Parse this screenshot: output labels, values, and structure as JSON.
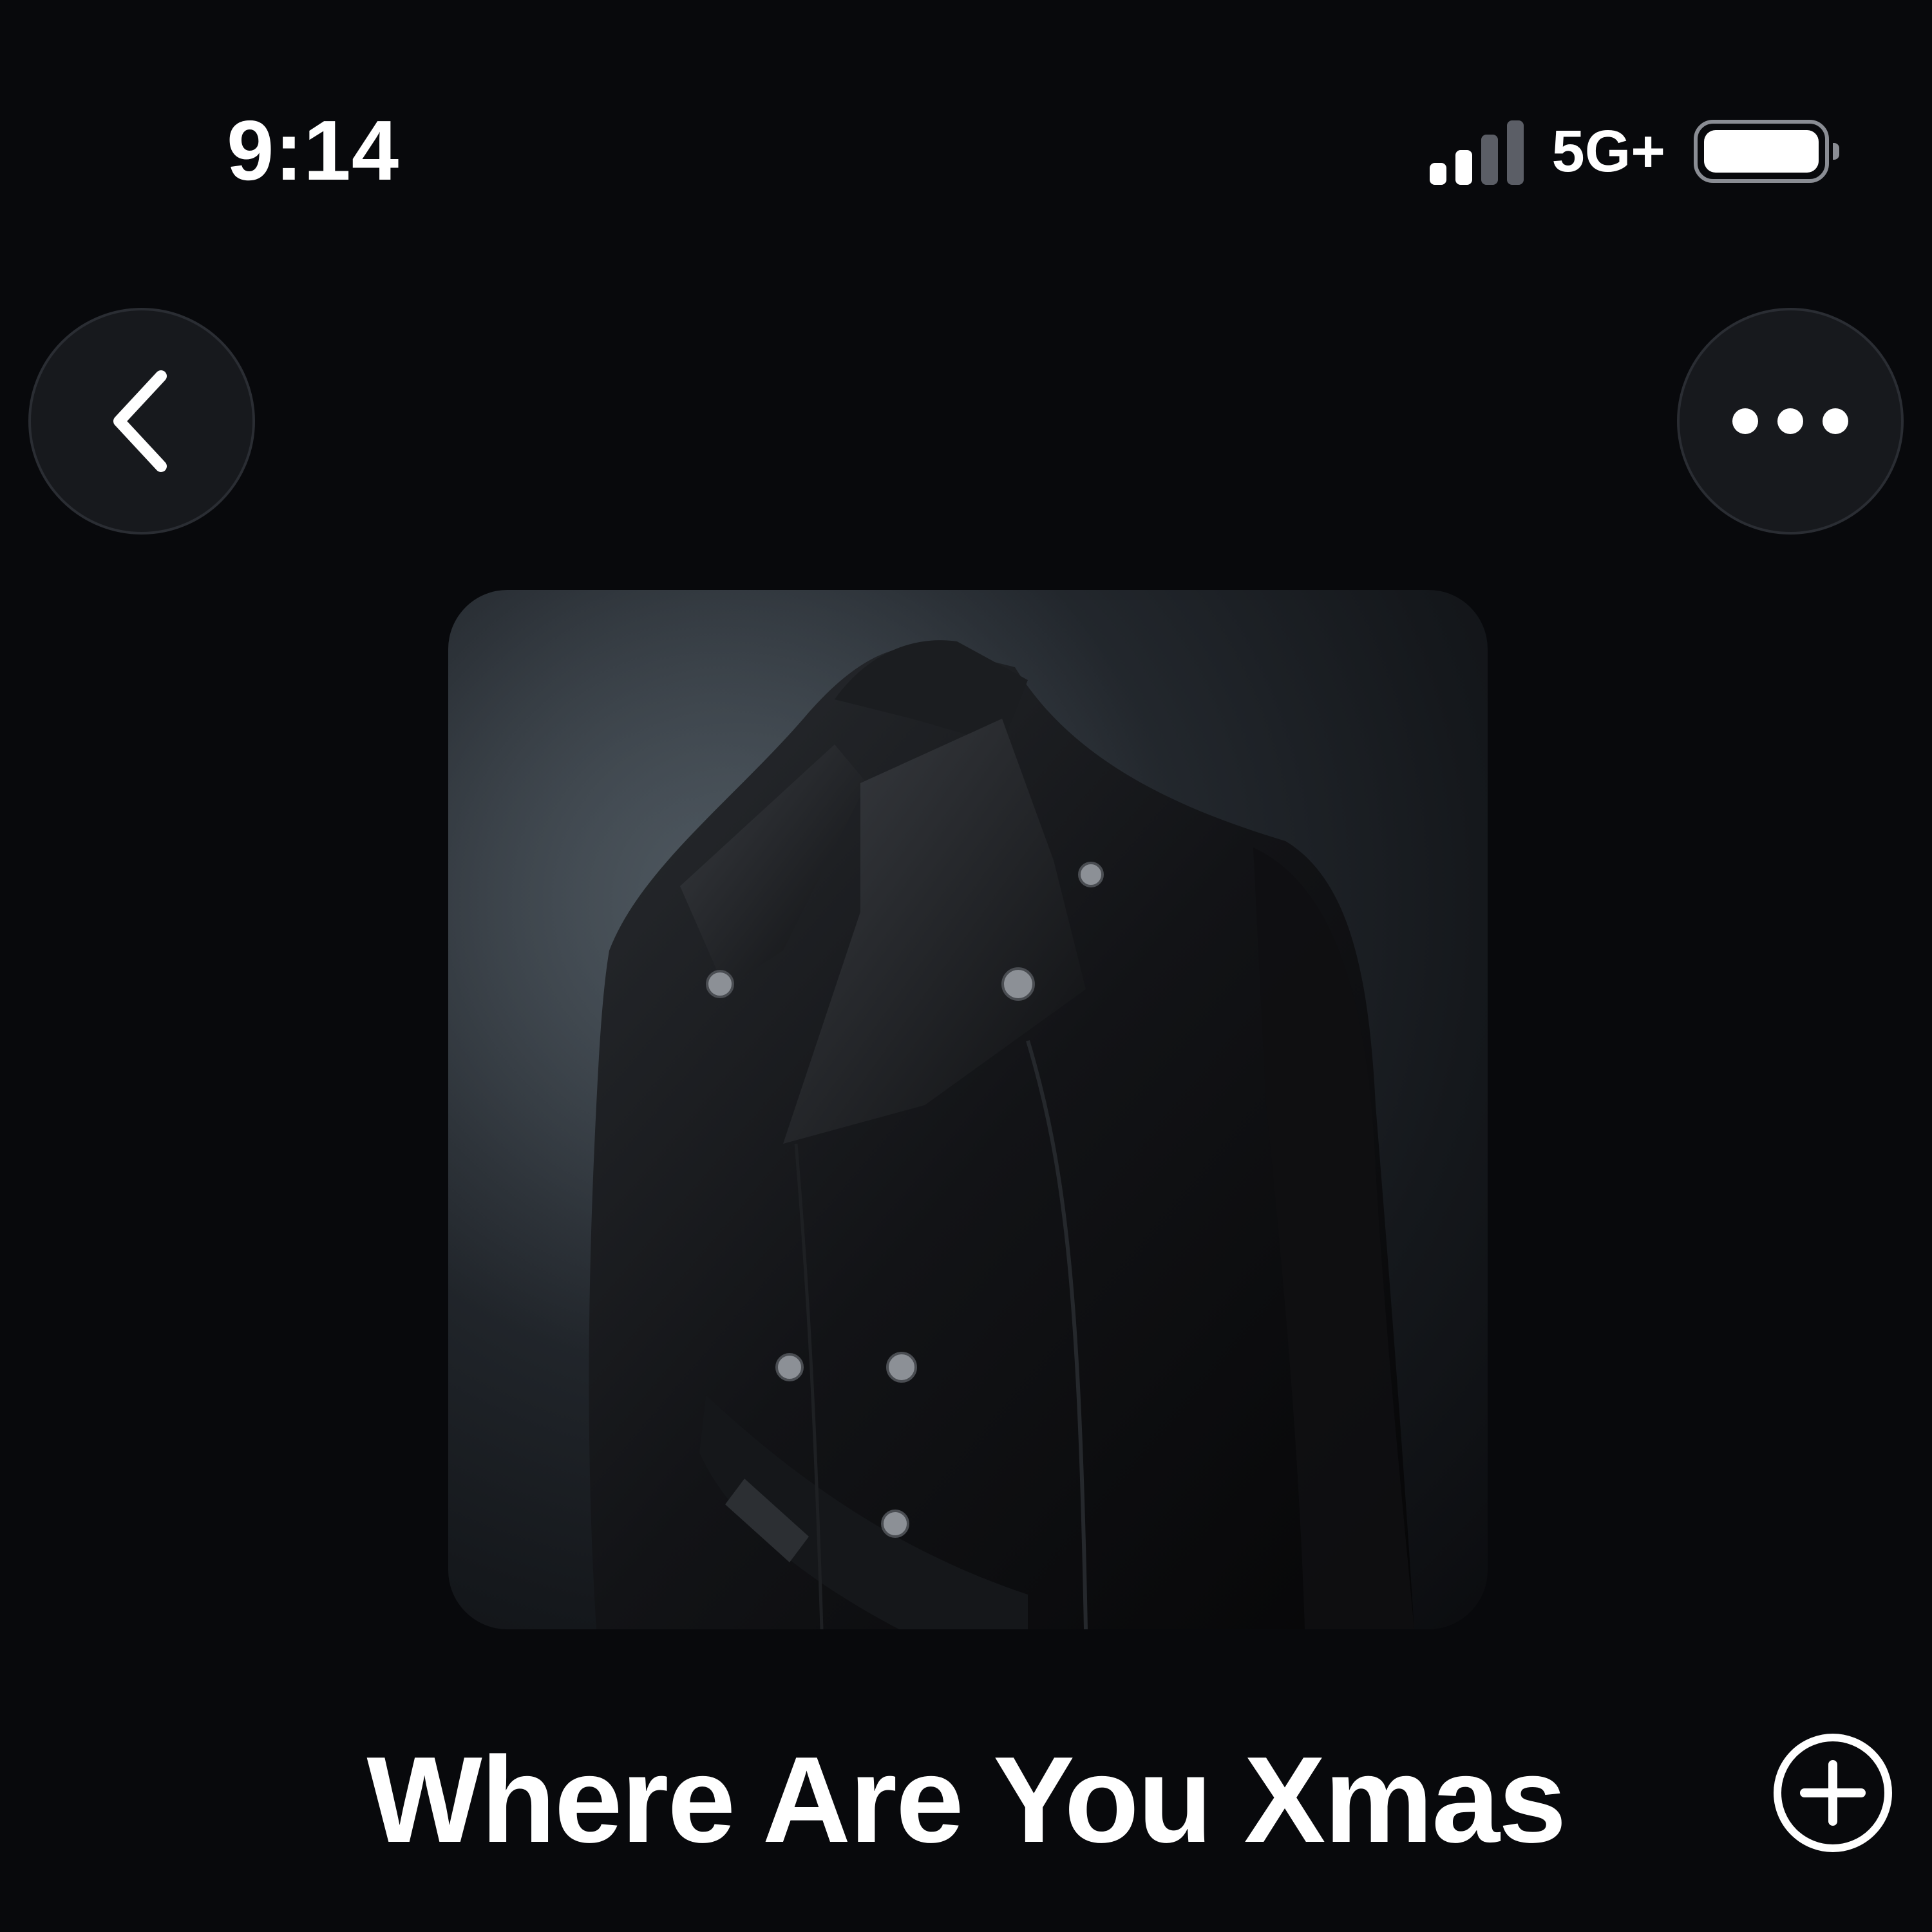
{
  "status_bar": {
    "time": "9:14",
    "network": "5G+",
    "signal_bars_active": 2,
    "signal_bars_total": 4,
    "battery_level": 1.0
  },
  "nav": {
    "back_icon": "chevron-left-icon",
    "more_icon": "ellipsis-icon"
  },
  "artwork": {
    "icon": "album-artwork-leather-coat"
  },
  "track": {
    "title": "Where Are You Xmas",
    "add_icon": "plus-circle-icon"
  },
  "colors": {
    "background": "#08090c",
    "button_bg": "#17191d",
    "text": "#ffffff"
  }
}
